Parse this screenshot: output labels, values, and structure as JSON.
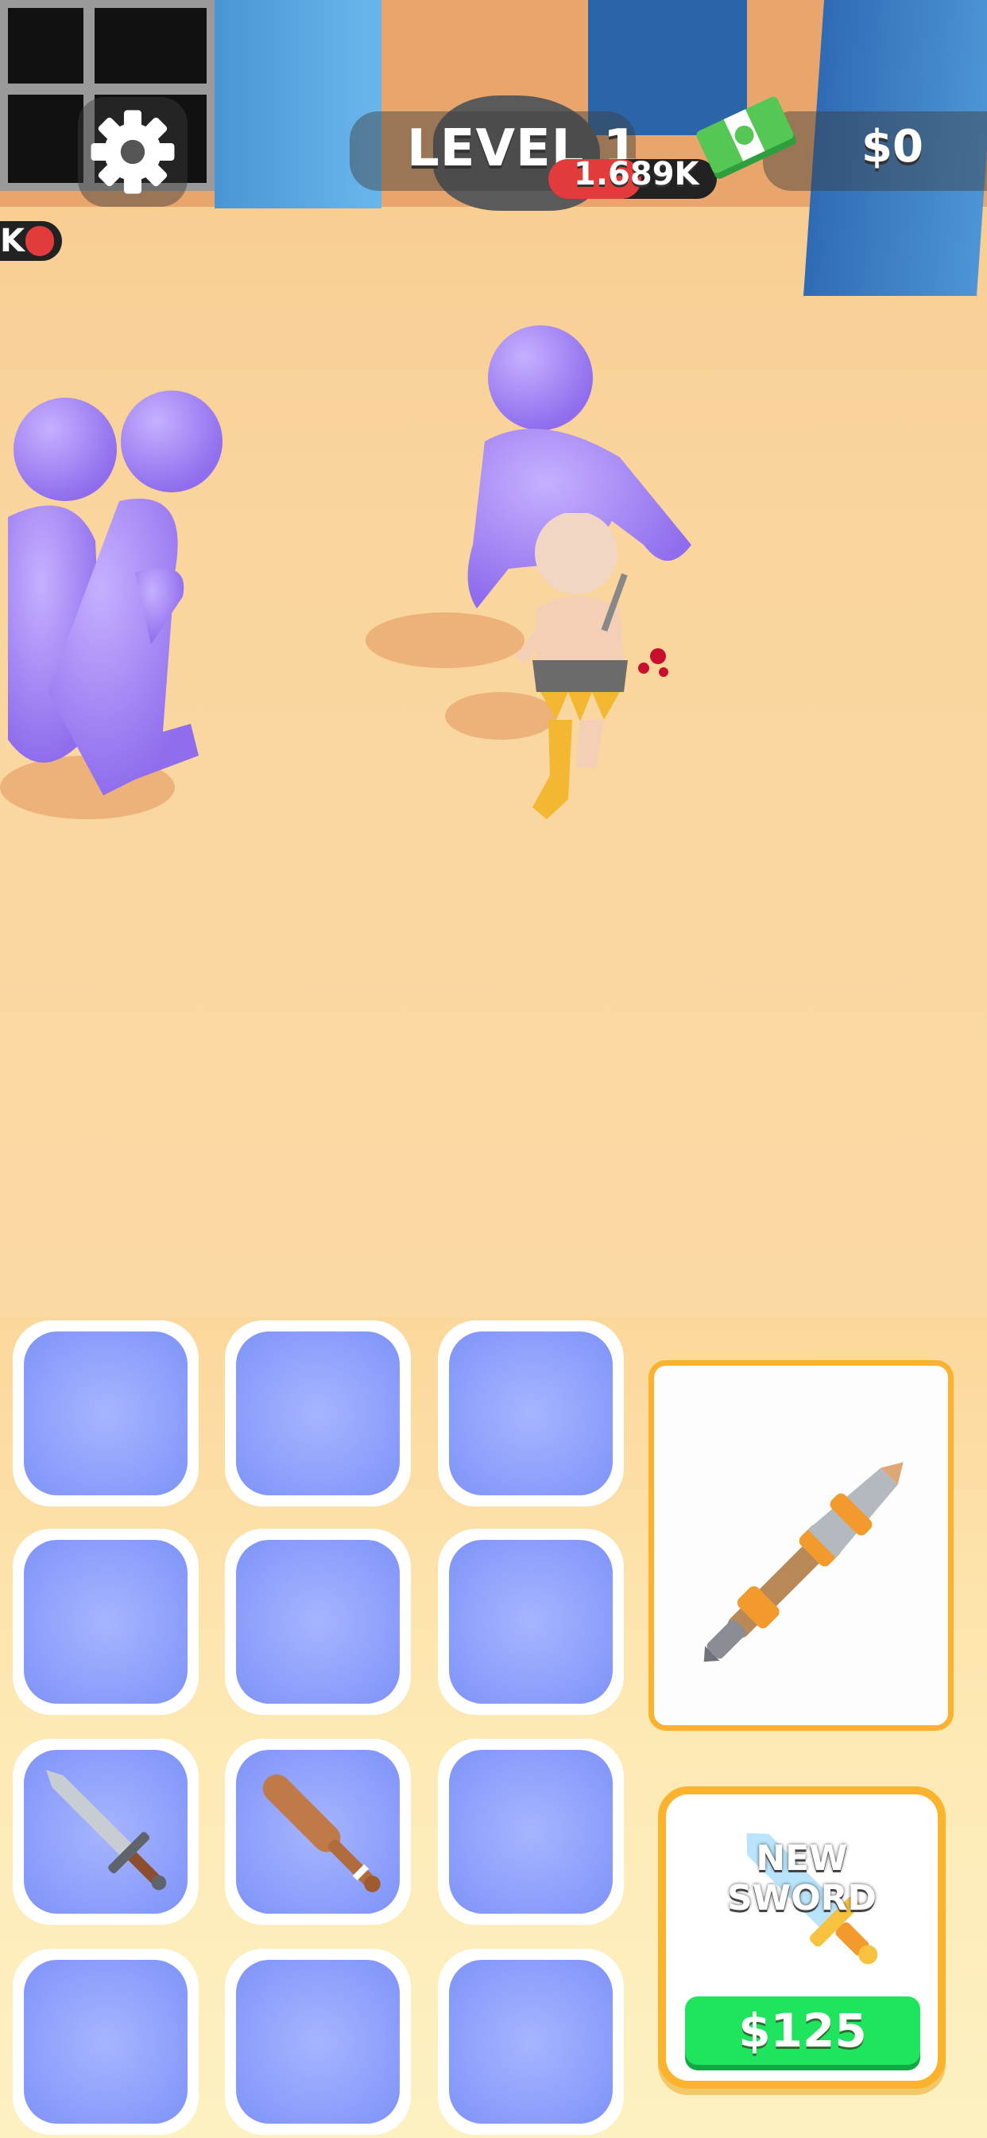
{
  "hud": {
    "settings_icon": "gear-icon",
    "level_label": "LEVEL 1",
    "player_power": "1.689K",
    "player_power_fill_fraction": 0.55,
    "cash_icon": "cash-stack-icon",
    "money": "$0",
    "offscreen_enemy_power": "K"
  },
  "merge_grid": {
    "rows": 4,
    "columns": 3,
    "slots": [
      {
        "row": 1,
        "col": 1,
        "item": null
      },
      {
        "row": 1,
        "col": 2,
        "item": null
      },
      {
        "row": 1,
        "col": 3,
        "item": null
      },
      {
        "row": 2,
        "col": 1,
        "item": null
      },
      {
        "row": 2,
        "col": 2,
        "item": null
      },
      {
        "row": 2,
        "col": 3,
        "item": null
      },
      {
        "row": 3,
        "col": 1,
        "item": "sword-icon"
      },
      {
        "row": 3,
        "col": 2,
        "item": "wooden-bat-icon"
      },
      {
        "row": 3,
        "col": 3,
        "item": null
      },
      {
        "row": 4,
        "col": 1,
        "item": null
      },
      {
        "row": 4,
        "col": 2,
        "item": null
      },
      {
        "row": 4,
        "col": 3,
        "item": null
      }
    ]
  },
  "equipped_weapon": {
    "icon": "spear-icon"
  },
  "shop": {
    "title_line1": "NEW",
    "title_line2": "SWORD",
    "icon": "sword-icon",
    "price": "$125"
  },
  "colors": {
    "floor": "#fbd9a4",
    "enemy": "#9b7af0",
    "slot": "#8a9dfb",
    "card_border": "#fbb22d",
    "buy_button": "#1fe45e",
    "power_bar": "#e23b3b"
  }
}
